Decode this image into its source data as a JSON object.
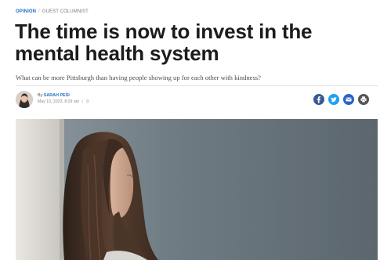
{
  "breadcrumb": {
    "section": "OPINION",
    "separator": "/",
    "subsection": "GUEST COLUMNIST"
  },
  "article": {
    "headline": "The time is now to invest in the mental health system",
    "dek": "What can be more Pittsburgh than having people showing up for each other with kindness?",
    "byline_prefix": "By",
    "author": "SARAH PESI",
    "date": "May 10, 2023, 8:29 am",
    "meta_separator": "|",
    "comment_count": "0"
  },
  "share": [
    {
      "icon": "facebook-icon",
      "color": "#3b5998"
    },
    {
      "icon": "twitter-icon",
      "color": "#1da1f2"
    },
    {
      "icon": "email-icon",
      "color": "#2a63c9"
    },
    {
      "icon": "print-icon",
      "color": "#555555"
    }
  ],
  "hero_image": {
    "subject": "photo-of-young-woman-leaning-against-wall"
  },
  "colors": {
    "accent": "#1f6fc9",
    "headline": "#1c1c1c",
    "dek": "#4d4d4d"
  }
}
